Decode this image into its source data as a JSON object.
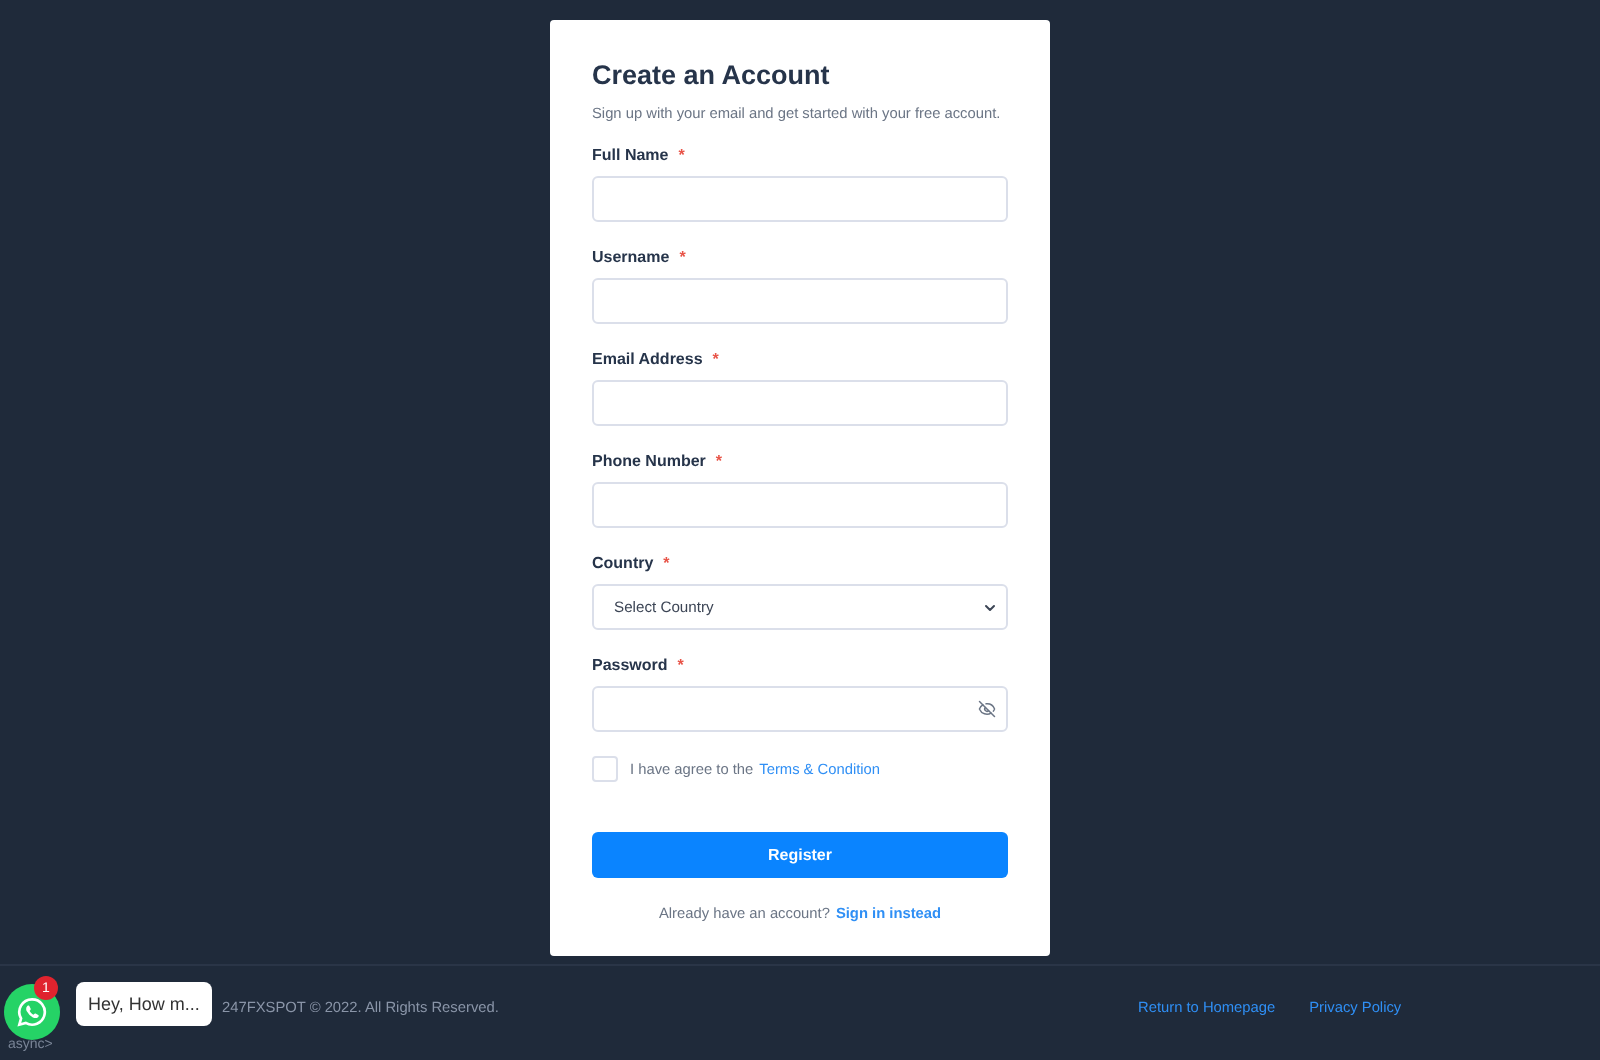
{
  "card": {
    "title": "Create an Account",
    "subtitle": "Sign up with your email and get started with your free account.",
    "fields": [
      {
        "kind": "text",
        "label": "Full Name",
        "required_mark": "*"
      },
      {
        "kind": "text",
        "label": "Username",
        "required_mark": "*"
      },
      {
        "kind": "text",
        "label": "Email Address",
        "required_mark": "*"
      },
      {
        "kind": "text",
        "label": "Phone Number",
        "required_mark": "*"
      },
      {
        "kind": "select",
        "label": "Country",
        "required_mark": "*",
        "value": "Select Country"
      },
      {
        "kind": "password",
        "label": "Password",
        "required_mark": "*"
      }
    ],
    "agree": {
      "checked": false,
      "text": "I have agree to the",
      "link": "Terms & Condition"
    },
    "submit": "Register",
    "signin": {
      "text": "Already have an account?",
      "link": "Sign in instead"
    }
  },
  "footer": {
    "copyright": "247FXSPOT © 2022. All Rights Reserved.",
    "links": [
      "Return to Homepage",
      "Privacy Policy"
    ]
  },
  "chat": {
    "badge": "1",
    "bubble": "Hey, How m...",
    "caption": "async>"
  }
}
